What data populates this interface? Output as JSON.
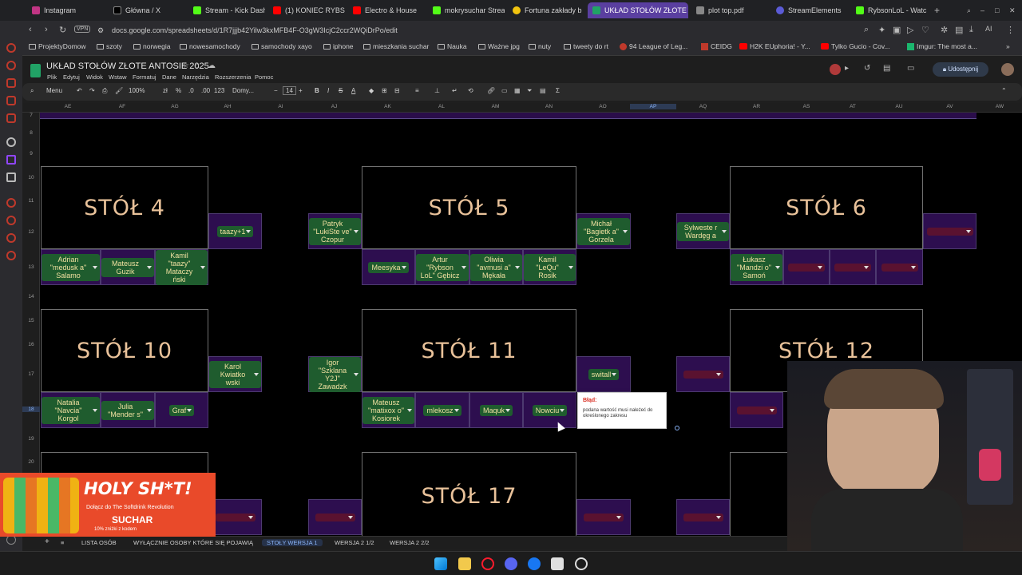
{
  "browser": {
    "tabs": [
      {
        "label": "Instagram",
        "color": "#c13584"
      },
      {
        "label": "Główna / X",
        "color": "#000000"
      },
      {
        "label": "Stream - Kick Dash",
        "color": "#53fc18"
      },
      {
        "label": "(1) KONIEC RYBSO",
        "color": "#ff0000"
      },
      {
        "label": "Electro & House",
        "color": "#ff0000"
      },
      {
        "label": "mokrysuchar Strea",
        "color": "#53fc18"
      },
      {
        "label": "Fortuna zakłady b",
        "color": "#f1c40f"
      },
      {
        "label": "UKŁAD STOŁÓW ZŁOTE A",
        "color": "#21a366"
      },
      {
        "label": "plot top.pdf",
        "color": "#888888"
      },
      {
        "label": "StreamElements",
        "color": "#5b5bd6"
      },
      {
        "label": "RybsonLoL - Watc",
        "color": "#53fc18"
      }
    ],
    "vpn_label": "VPN",
    "url": "docs.google.com/spreadsheets/d/1R7jjjb42Yilw3kxMFB4F-O3gW3IcjC2ccr2WQiDrPo/edit",
    "ai_label": "AI"
  },
  "bookmarks": [
    "ProjektyDomow",
    "szoty",
    "norwegia",
    "nowesamochody",
    "samochody xayo",
    "iphone",
    "mieszkania suchar",
    "Nauka",
    "Ważne jpg",
    "nuty",
    "tweety do rt",
    "94 League of Leg...",
    "CEIDG",
    "H2K EUphoria! - Y...",
    "Tylko Gucio - Cov...",
    "Imgur: The most a..."
  ],
  "sheets": {
    "title": "UKŁAD STOŁÓW ZŁOTE ANTOSIE 2025",
    "menu": [
      "Plik",
      "Edytuj",
      "Widok",
      "Wstaw",
      "Formatuj",
      "Dane",
      "Narzędzia",
      "Rozszerzenia",
      "Pomoc"
    ],
    "share_label": "Udostępnij",
    "toolbar": {
      "menu_label": "Menu",
      "zoom": "100%",
      "currency": "zł",
      "percent": "%",
      "dec_less": ".0",
      "dec_more": ".00",
      "format_123": "123",
      "font": "Domy...",
      "font_size": "14"
    },
    "columns": [
      "AE",
      "AF",
      "AG",
      "AH",
      "AI",
      "AJ",
      "AK",
      "AL",
      "AM",
      "AN",
      "AO",
      "AP",
      "AQ",
      "AR",
      "AS",
      "AT",
      "AU",
      "AV",
      "AW"
    ],
    "selected_column": "AP",
    "rows": [
      "7",
      "8",
      "9",
      "10",
      "11",
      "12",
      "13",
      "14",
      "15",
      "16",
      "17",
      "18",
      "19",
      "20"
    ],
    "selected_row": "18",
    "tables": [
      "STÓŁ 4",
      "STÓŁ 5",
      "STÓŁ 6",
      "STÓŁ 10",
      "STÓŁ 11",
      "STÓŁ 12",
      "STÓŁ 17"
    ],
    "table4": {
      "side": "taazy+1",
      "bottom": [
        "Adrian \"medusk a\" Salamo",
        "Mateusz Guzik",
        "Kamil \"taazy\" Mataczy ński"
      ]
    },
    "table5": {
      "left": "Patryk \"LukiSte ve\" Czopur",
      "right": "Michał \"Bagietk a\" Gorzela",
      "bottom": [
        "Meesyka",
        "Artur \"Rybson LoL\" Gębicz",
        "Oliwia \"avmusi a\" Mękała",
        "Kamil \"LeQu\" Rosik"
      ]
    },
    "table6": {
      "left": "Sylweste r Wardęg a",
      "bottom_first": "Łukasz \"Mandzi o\" Samoń"
    },
    "table10": {
      "side": "Karol Kwiatko wski",
      "bottom": [
        "Natalia \"Navcia\" Korgol",
        "Julia \"Mender s\"",
        "Graf"
      ]
    },
    "table11": {
      "left": "Igor \"Szklana Y2J\" Zawadzk",
      "right": "switall",
      "bottom": [
        "Mateusz \"matixox o\" Kosiorek",
        "mlekosz",
        "Maquk",
        "Nowciu"
      ]
    },
    "error": {
      "title": "Błąd:",
      "text": "podana wartość musi należeć do określonego zakresu"
    },
    "sheet_tabs": [
      "LISTA OSÓB",
      "WYŁĄCZNIE OSOBY KTÓRE SIĘ POJAWIĄ",
      "STOŁY WERSJA 1",
      "WERSJA 2 1/2",
      "WERSJA 2 2/2"
    ],
    "active_sheet_tab": "STOŁY WERSJA 1"
  },
  "promo": {
    "headline": "HOLY SH*T!",
    "line1": "Dołącz do The Softdrink Revolution",
    "code": "SUCHAR",
    "line2": "10% zniżki z kodem"
  }
}
